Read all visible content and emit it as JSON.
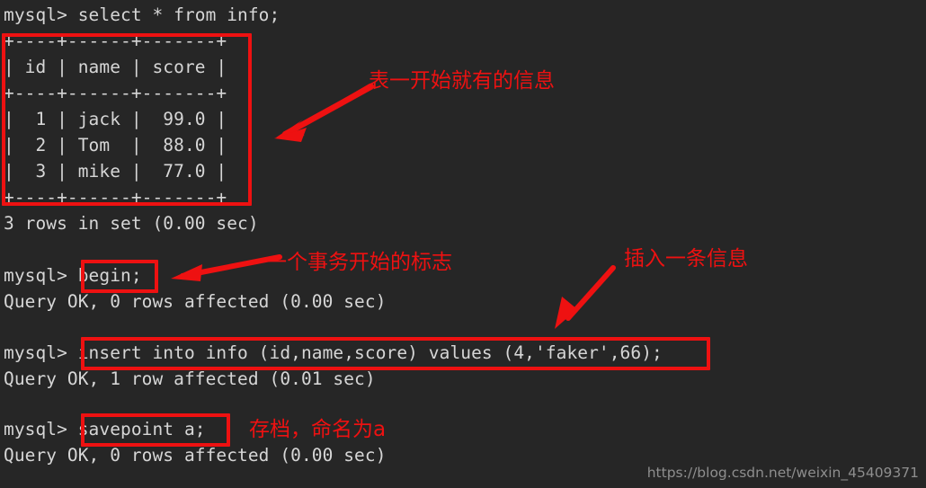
{
  "terminal": {
    "background": "#262626",
    "foreground": "#d6d6d6",
    "lines": [
      {
        "id": "l0",
        "text": "mysql> select * from info;"
      },
      {
        "id": "l1",
        "text": "+----+------+-------+"
      },
      {
        "id": "l2",
        "text": "| id | name | score |"
      },
      {
        "id": "l3",
        "text": "+----+------+-------+"
      },
      {
        "id": "l4",
        "text": "|  1 | jack |  99.0 |"
      },
      {
        "id": "l5",
        "text": "|  2 | Tom  |  88.0 |"
      },
      {
        "id": "l6",
        "text": "|  3 | mike |  77.0 |"
      },
      {
        "id": "l7",
        "text": "+----+------+-------+"
      },
      {
        "id": "l8",
        "text": "3 rows in set (0.00 sec)"
      },
      {
        "id": "l9",
        "text": ""
      },
      {
        "id": "l10",
        "text": "mysql> begin;"
      },
      {
        "id": "l11",
        "text": "Query OK, 0 rows affected (0.00 sec)"
      },
      {
        "id": "l12",
        "text": ""
      },
      {
        "id": "l13",
        "text": "mysql> insert into info (id,name,score) values (4,'faker',66);"
      },
      {
        "id": "l14",
        "text": "Query OK, 1 row affected (0.01 sec)"
      },
      {
        "id": "l15",
        "text": ""
      },
      {
        "id": "l16",
        "text": "mysql> savepoint a;"
      },
      {
        "id": "l17",
        "text": "Query OK, 0 rows affected (0.00 sec)"
      }
    ],
    "result_table": {
      "columns": [
        "id",
        "name",
        "score"
      ],
      "rows": [
        [
          "1",
          "jack",
          "99.0"
        ],
        [
          "2",
          "Tom",
          "88.0"
        ],
        [
          "3",
          "mike",
          "77.0"
        ]
      ],
      "footer": "3 rows in set (0.00 sec)"
    }
  },
  "annotations": {
    "color": "#ee1111",
    "notes": [
      {
        "id": "note-table",
        "text": "表一开始就有的信息"
      },
      {
        "id": "note-begin",
        "text": "一个事务开始的标志"
      },
      {
        "id": "note-insert",
        "text": "插入一条信息"
      },
      {
        "id": "note-savepoint",
        "text": "存档，命名为a"
      }
    ],
    "highlight_boxes": [
      {
        "id": "box-result-table",
        "target": "select result table"
      },
      {
        "id": "box-begin",
        "target": "begin;"
      },
      {
        "id": "box-insert",
        "target": "insert into info (id,name,score) values (4,'faker',66);"
      },
      {
        "id": "box-savepoint",
        "target": "savepoint a;"
      }
    ]
  },
  "watermark": {
    "text": "https://blog.csdn.net/weixin_45409371"
  }
}
